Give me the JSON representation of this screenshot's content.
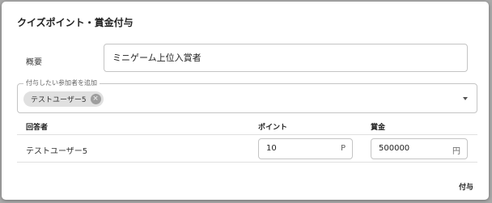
{
  "dialog": {
    "title": "クイズポイント・賞金付与"
  },
  "summary": {
    "label": "概要",
    "value": "ミニゲーム上位入賞者"
  },
  "participants": {
    "legend": "付与したい参加者を追加",
    "chips": [
      {
        "label": "テストユーザー5"
      }
    ]
  },
  "table": {
    "headers": {
      "respondent": "回答者",
      "points": "ポイント",
      "prize": "賞金"
    },
    "rows": [
      {
        "name": "テストユーザー5",
        "points": "10",
        "points_unit": "P",
        "prize": "500000",
        "prize_unit": "円"
      }
    ]
  },
  "actions": {
    "grant_label": "付与"
  },
  "icons": {
    "chip_delete": "cancel-icon",
    "dropdown": "arrow-drop-down-icon"
  },
  "colors": {
    "backdrop": "#a9a9a9",
    "dialog": "#ffffff",
    "chip": "#e0e0e0",
    "border": "#c4c4c4"
  }
}
